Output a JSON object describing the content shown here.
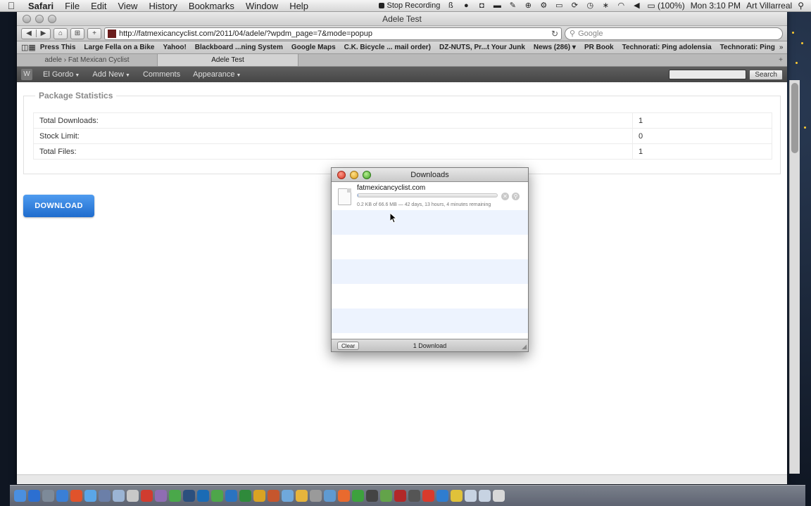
{
  "menubar": {
    "apple_icon": "apple-icon",
    "app_name": "Safari",
    "menus": [
      "File",
      "Edit",
      "View",
      "History",
      "Bookmarks",
      "Window",
      "Help"
    ],
    "stop_recording": "Stop Recording",
    "battery": "(100%)",
    "clock": "Mon 3:10 PM",
    "user": "Art Villarreal"
  },
  "browser": {
    "window_title": "Adele Test",
    "url": "http://fatmexicancyclist.com/2011/04/adele/?wpdm_page=7&mode=popup",
    "search_placeholder": "Google",
    "bookmarks": [
      "Press This",
      "Large Fella on a Bike",
      "Yahoo!",
      "Blackboard ...ning System",
      "Google Maps",
      "C.K. Bicycle ... mail order)",
      "DZ-NUTS, Pr...t Your Junk",
      "News (286) ▾",
      "PR Book",
      "Technorati: Ping adolensia",
      "Technorati: Ping"
    ],
    "tabs": [
      {
        "label": "adele › Fat Mexican Cyclist",
        "active": false
      },
      {
        "label": "Adele Test",
        "active": true
      }
    ]
  },
  "adminbar": {
    "items": [
      "El Gordo",
      "Add New",
      "Comments",
      "Appearance"
    ],
    "search_button": "Search"
  },
  "page": {
    "stats_legend": "Package Statistics",
    "rows": [
      {
        "label": "Total Downloads:",
        "value": "1"
      },
      {
        "label": "Stock Limit:",
        "value": "0"
      },
      {
        "label": "Total Files:",
        "value": "1"
      }
    ],
    "download_button": "DOWNLOAD"
  },
  "downloads_panel": {
    "title": "Downloads",
    "item": {
      "filename": "fatmexicancyclist.com",
      "progress_fraction": 0.003,
      "status": "0.2 KB of 66.6 MB — 42 days, 13 hours, 4 minutes remaining"
    },
    "clear_button": "Clear",
    "count_label": "1 Download"
  }
}
